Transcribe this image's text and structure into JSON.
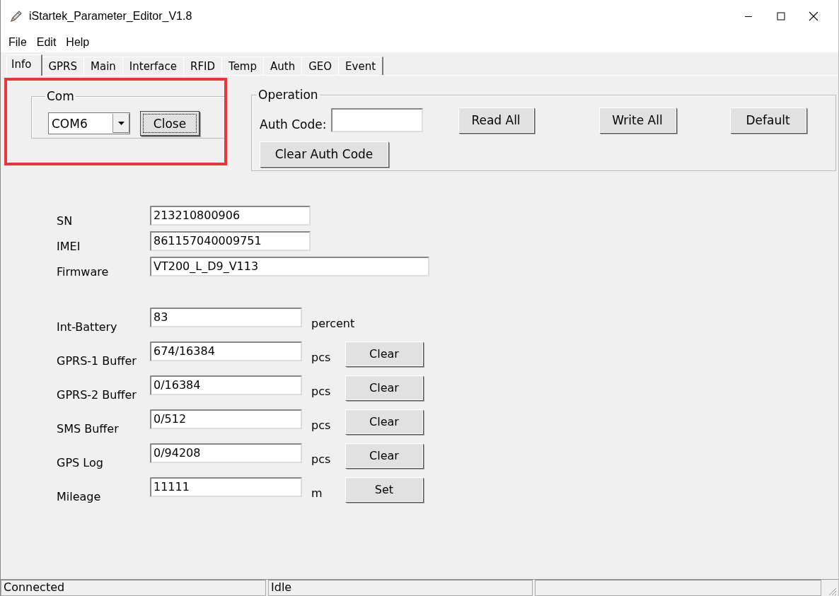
{
  "window": {
    "title": "iStartek_Parameter_Editor_V1.8"
  },
  "menu": [
    "File",
    "Edit",
    "Help"
  ],
  "tabs": [
    {
      "label": "Info",
      "selected": true
    },
    {
      "label": "GPRS",
      "selected": false
    },
    {
      "label": "Main",
      "selected": false
    },
    {
      "label": "Interface",
      "selected": false
    },
    {
      "label": "RFID",
      "selected": false
    },
    {
      "label": "Temp",
      "selected": false
    },
    {
      "label": "Auth",
      "selected": false
    },
    {
      "label": "GEO",
      "selected": false
    },
    {
      "label": "Event",
      "selected": false
    }
  ],
  "com_group": {
    "title": "Com",
    "port": "COM6",
    "button": "Close",
    "highlighted": true
  },
  "operation": {
    "title": "Operation",
    "auth_code_label": "Auth Code:",
    "buttons": [
      "Read All",
      "Write All",
      "Default"
    ],
    "clear_button": "Clear Auth Code"
  },
  "device": [
    {
      "label": "SN",
      "value": "213210800906",
      "kind": "short"
    },
    {
      "label": "IMEI",
      "value": "861157040009751",
      "kind": "short"
    },
    {
      "label": "Firmware",
      "value": "VT200_L_D9_V113",
      "kind": "long"
    }
  ],
  "counters": [
    {
      "label": "Int-Battery",
      "value": "83",
      "unit": "percent"
    },
    {
      "label": "GPRS-1 Buffer",
      "value": "674/16384",
      "unit": "pcs",
      "button": "Clear"
    },
    {
      "label": "GPRS-2 Buffer",
      "value": "0/16384",
      "unit": "pcs",
      "button": "Clear"
    },
    {
      "label": "SMS Buffer",
      "value": "0/512",
      "unit": "pcs",
      "button": "Clear"
    },
    {
      "label": "GPS Log",
      "value": "0/94208",
      "unit": "pcs",
      "button": "Clear"
    },
    {
      "label": "Mileage",
      "value": "11111",
      "unit": "m",
      "button": "Set"
    }
  ],
  "status_bar": [
    "Connected",
    "Idle"
  ]
}
